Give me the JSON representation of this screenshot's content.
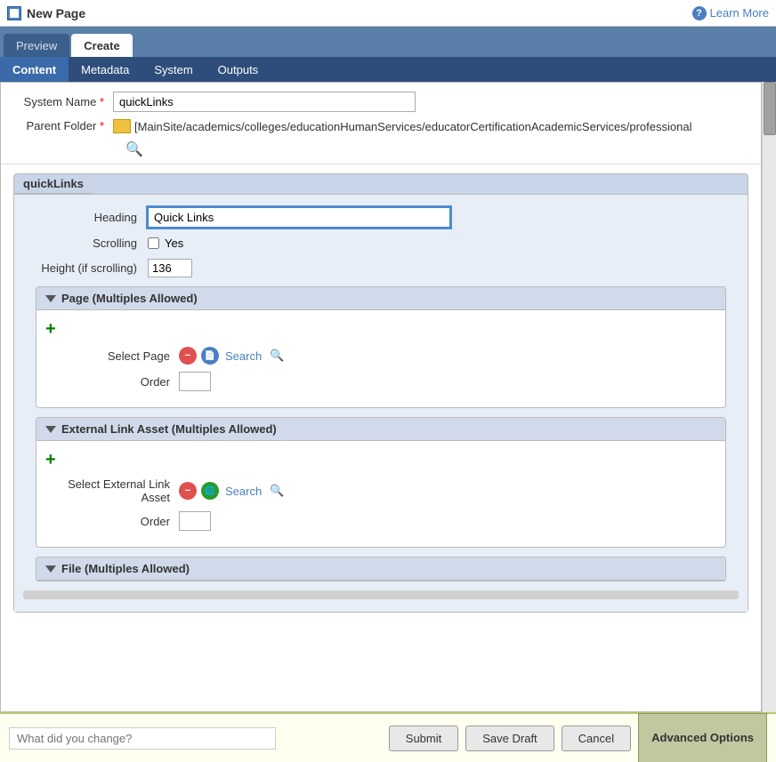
{
  "titleBar": {
    "icon": "page-icon",
    "title": "New Page",
    "helpText": "Learn More"
  },
  "tabs": [
    {
      "id": "preview",
      "label": "Preview",
      "active": false
    },
    {
      "id": "create",
      "label": "Create",
      "active": true
    }
  ],
  "subTabs": [
    {
      "id": "content",
      "label": "Content",
      "active": true
    },
    {
      "id": "metadata",
      "label": "Metadata",
      "active": false
    },
    {
      "id": "system",
      "label": "System",
      "active": false
    },
    {
      "id": "outputs",
      "label": "Outputs",
      "active": false
    }
  ],
  "form": {
    "systemNameLabel": "System Name",
    "systemNameValue": "quickLinks",
    "parentFolderLabel": "Parent Folder",
    "parentFolderPath": "[MainSite/academics/colleges/educationHumanServices/educatorCertificationAcademicServices/professional"
  },
  "quickLinksPanel": {
    "title": "quickLinks",
    "headingLabel": "Heading",
    "headingValue": "Quick Links",
    "scrollingLabel": "Scrolling",
    "scrollingYesLabel": "Yes",
    "heightLabel": "Height (if scrolling)",
    "heightValue": "136"
  },
  "pageMultiple": {
    "title": "Page (Multiples Allowed)",
    "selectPageLabel": "Select Page",
    "searchText": "Search",
    "orderLabel": "Order"
  },
  "externalLinkAsset": {
    "title": "External Link Asset (Multiples Allowed)",
    "selectLabel": "Select External Link Asset",
    "searchText": "Search",
    "orderLabel": "Order"
  },
  "fileMultiple": {
    "title": "File (Multiples Allowed)"
  },
  "bottomBar": {
    "changePlaceholder": "What did you change?",
    "submitLabel": "Submit",
    "saveDraftLabel": "Save Draft",
    "cancelLabel": "Cancel",
    "advancedLabel": "Advanced Options"
  }
}
